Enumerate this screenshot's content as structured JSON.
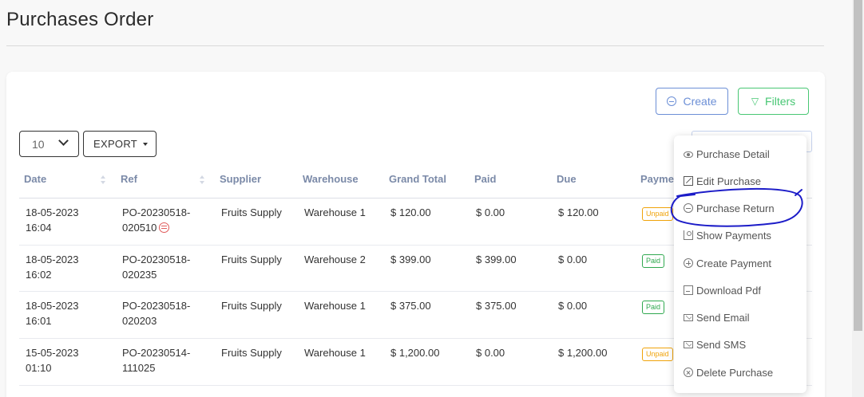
{
  "page": {
    "title": "Purchases Order"
  },
  "toolbar": {
    "create_label": "Create",
    "filters_label": "Filters",
    "page_size": "10",
    "export_label": "EXPORT"
  },
  "table": {
    "headers": [
      "Date",
      "Ref",
      "Supplier",
      "Warehouse",
      "Grand Total",
      "Paid",
      "Due",
      "Payme"
    ],
    "rows": [
      {
        "date": "18-05-2023",
        "time": "16:04",
        "ref1": "PO-20230518-",
        "ref2": "020510",
        "supplier": "Fruits Supply",
        "warehouse": "Warehouse 1",
        "grand_total": "$ 120.00",
        "paid": "$ 0.00",
        "due": "$ 120.00",
        "status": "Unpaid",
        "has_return": true
      },
      {
        "date": "18-05-2023",
        "time": "16:02",
        "ref1": "PO-20230518-",
        "ref2": "020235",
        "supplier": "Fruits Supply",
        "warehouse": "Warehouse 2",
        "grand_total": "$ 399.00",
        "paid": "$ 399.00",
        "due": "$ 0.00",
        "status": "Paid",
        "has_return": false
      },
      {
        "date": "18-05-2023",
        "time": "16:01",
        "ref1": "PO-20230518-",
        "ref2": "020203",
        "supplier": "Fruits Supply",
        "warehouse": "Warehouse 1",
        "grand_total": "$ 375.00",
        "paid": "$ 375.00",
        "due": "$ 0.00",
        "status": "Paid",
        "has_return": false
      },
      {
        "date": "15-05-2023",
        "time": "01:10",
        "ref1": "PO-20230514-",
        "ref2": "111025",
        "supplier": "Fruits Supply",
        "warehouse": "Warehouse 1",
        "grand_total": "$ 1,200.00",
        "paid": "$ 0.00",
        "due": "$ 1,200.00",
        "status": "Unpaid",
        "has_return": false
      }
    ]
  },
  "dropdown": {
    "items": [
      {
        "label": "Purchase Detail",
        "icon": "eye-icon"
      },
      {
        "label": "Edit Purchase",
        "icon": "edit-icon"
      },
      {
        "label": "Purchase Return",
        "icon": "return-icon"
      },
      {
        "label": "Show Payments",
        "icon": "payments-icon"
      },
      {
        "label": "Create Payment",
        "icon": "plus-circle-icon"
      },
      {
        "label": "Download Pdf",
        "icon": "file-pdf-icon"
      },
      {
        "label": "Send Email",
        "icon": "mail-icon"
      },
      {
        "label": "Send SMS",
        "icon": "sms-icon"
      },
      {
        "label": "Delete Purchase",
        "icon": "delete-icon"
      }
    ]
  },
  "colors": {
    "create_accent": "#6c8fd6",
    "filters_accent": "#48c774",
    "unpaid": "#f0a30a",
    "paid": "#2fa84f",
    "annotation": "#1c1cc8"
  }
}
